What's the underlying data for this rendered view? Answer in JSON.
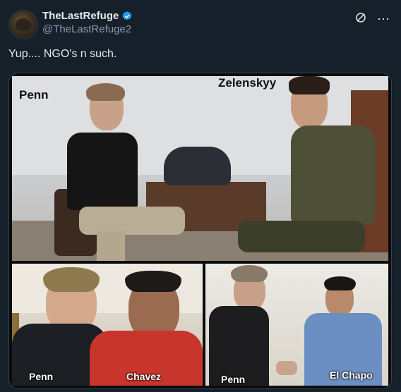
{
  "tweet": {
    "display_name": "TheLastRefuge",
    "handle": "@TheLastRefuge2",
    "text": "Yup.... NGO's n such.",
    "verified_icon": "verified-badge-icon",
    "grok_icon": "grok-icon",
    "more_icon": "more-icon"
  },
  "media": {
    "top_labels": {
      "left": "Penn",
      "right": "Zelenskyy"
    },
    "bottom_left_labels": {
      "left": "Penn",
      "right": "Chavez"
    },
    "bottom_right_labels": {
      "left": "Penn",
      "right": "El Chapo"
    }
  },
  "colors": {
    "background": "#15202b",
    "verified": "#1d9bf0",
    "handle": "#8b98a5"
  }
}
